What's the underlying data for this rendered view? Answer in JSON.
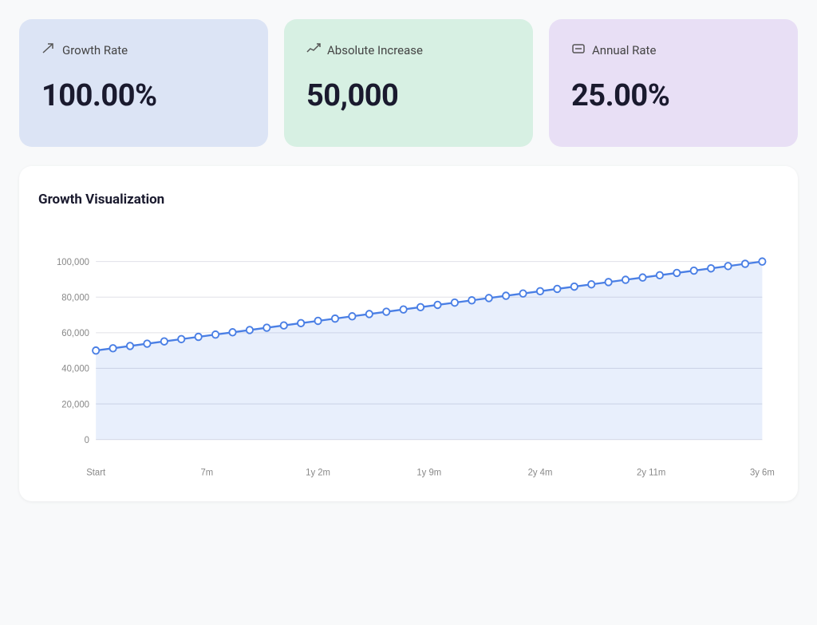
{
  "metrics": [
    {
      "id": "growth-rate",
      "label": "Growth Rate",
      "value": "100.00%",
      "icon": "↗",
      "color": "blue"
    },
    {
      "id": "absolute-increase",
      "label": "Absolute Increase",
      "value": "50,000",
      "icon": "↗~",
      "color": "green"
    },
    {
      "id": "annual-rate",
      "label": "Annual Rate",
      "value": "25.00%",
      "icon": "⊟",
      "color": "purple"
    }
  ],
  "chart": {
    "title": "Growth Visualization",
    "y_labels": [
      "0",
      "20,000",
      "40,000",
      "60,000",
      "80,000",
      "100,000"
    ],
    "x_labels": [
      "Start",
      "7m",
      "1y 2m",
      "1y 9m",
      "2y 4m",
      "2y 11m",
      "3y 6m"
    ],
    "start_value": 50000,
    "end_value": 100000
  }
}
